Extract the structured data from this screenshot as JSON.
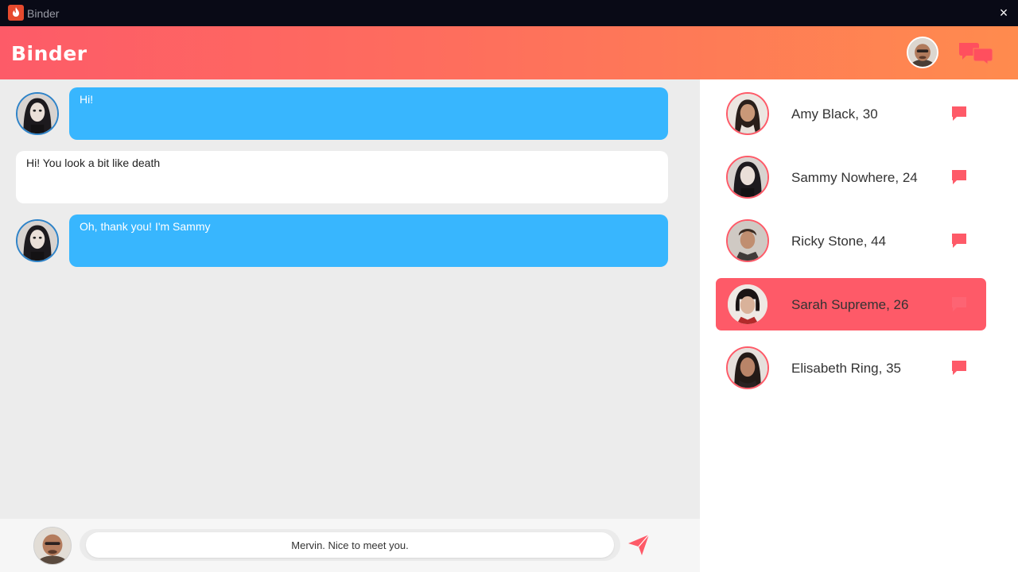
{
  "window": {
    "title": "Binder",
    "close_glyph": "×"
  },
  "header": {
    "brand": "Binder",
    "chat_icon": "chat-bubbles-icon"
  },
  "messages": [
    {
      "direction": "in",
      "text": "Hi!"
    },
    {
      "direction": "out",
      "text": "Hi! You look a bit like death"
    },
    {
      "direction": "in",
      "text": "Oh, thank you! I'm Sammy"
    }
  ],
  "composer": {
    "value": "Mervin. Nice to meet you.",
    "send_icon": "send-icon"
  },
  "contacts": [
    {
      "name": "Amy Black, 30",
      "active": false
    },
    {
      "name": "Sammy Nowhere, 24",
      "active": false
    },
    {
      "name": "Ricky Stone, 44",
      "active": false
    },
    {
      "name": "Sarah Supreme, 26",
      "active": true
    },
    {
      "name": "Elisabeth Ring, 35",
      "active": false
    }
  ],
  "colors": {
    "accent": "#fe5a68",
    "header_gradient_start": "#fd5b68",
    "header_gradient_end": "#ff8b4e",
    "incoming_bubble": "#38b6fe",
    "outgoing_bubble": "#ffffff",
    "titlebar": "#090a16"
  }
}
